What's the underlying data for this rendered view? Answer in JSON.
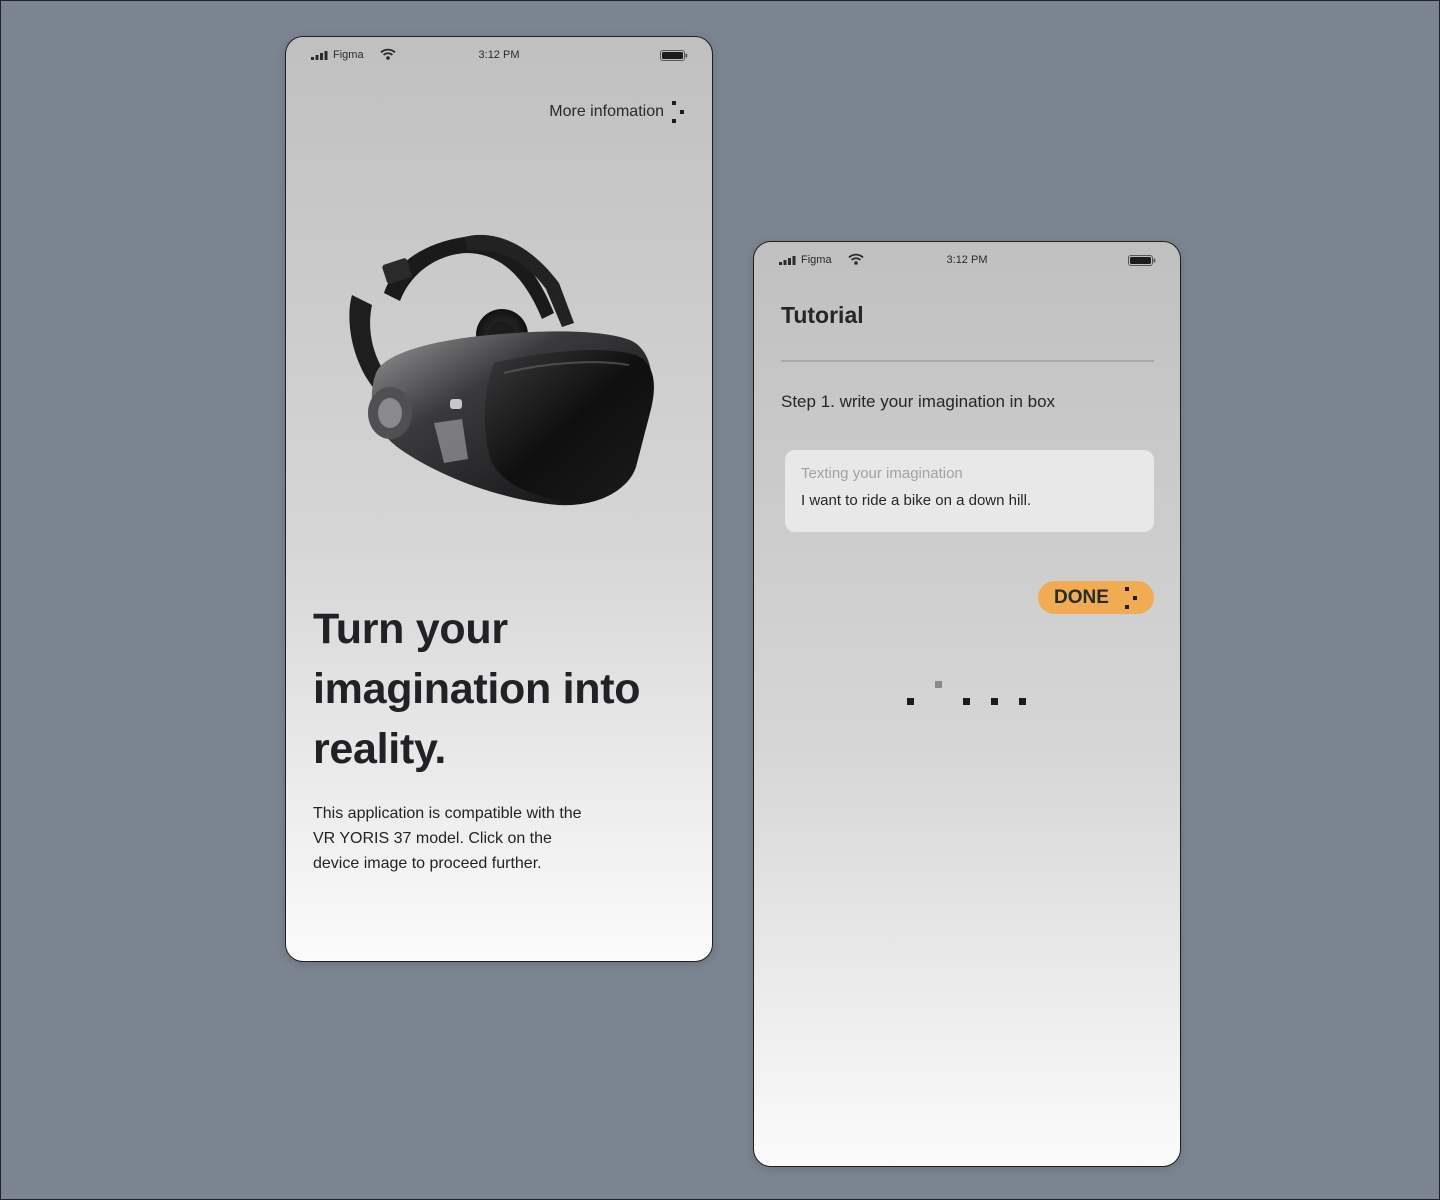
{
  "status_bar": {
    "carrier": "Figma",
    "time": "3:12 PM"
  },
  "screen_1": {
    "more_info_label": "More infomation",
    "headline": "Turn your imagination into reality.",
    "description": "This application is compatible with the VR YORIS 37 model. Click on the device image to proceed further."
  },
  "screen_2": {
    "title": "Tutorial",
    "step": "Step 1. write your imagination in box",
    "input_placeholder": "Texting your imagination",
    "input_value": "I want to ride a bike on a down hill.",
    "done_label": "DONE"
  },
  "colors": {
    "background": "#7b8591",
    "accent": "#f1ab52",
    "text": "#26262a"
  },
  "icons": [
    "signal-icon",
    "wifi-icon",
    "battery-icon",
    "more-dots-icon",
    "loading-dots-icon"
  ]
}
